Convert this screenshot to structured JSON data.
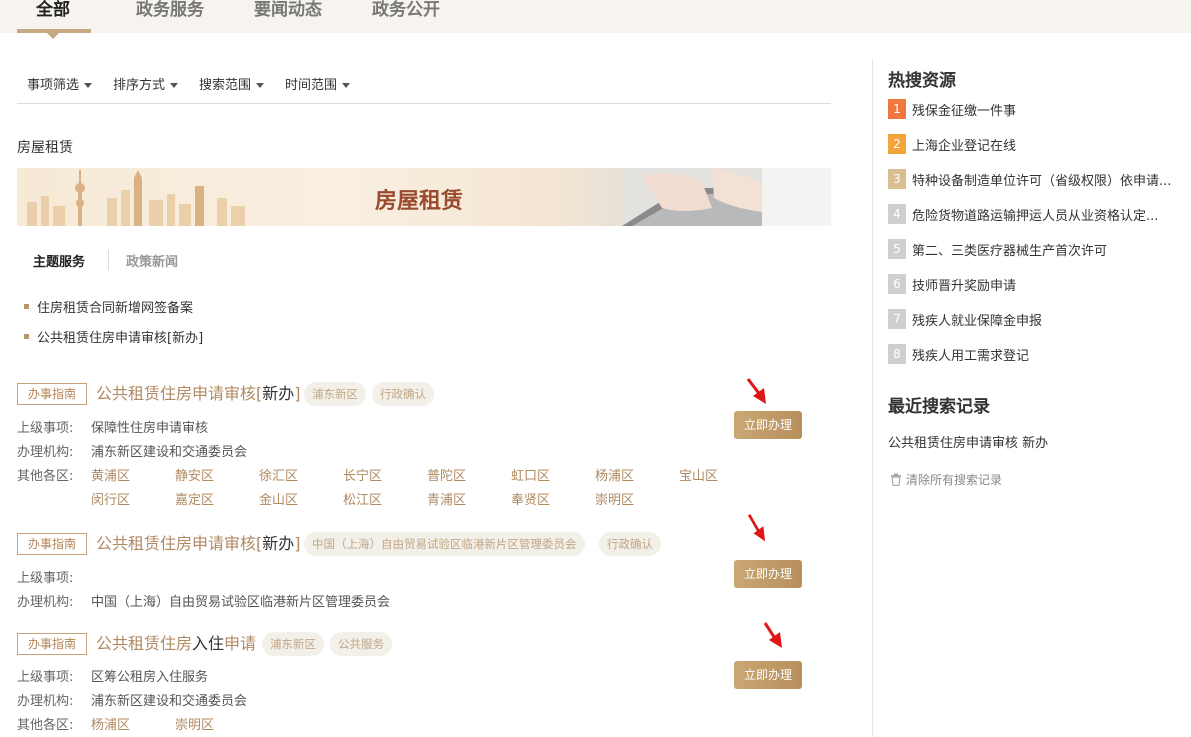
{
  "tabs": [
    "全部",
    "政务服务",
    "要闻动态",
    "政务公开"
  ],
  "filters": [
    "事项筛选",
    "排序方式",
    "搜索范围",
    "时间范围"
  ],
  "section_title": "房屋租赁",
  "banner_title": "房屋租赁",
  "subtabs": {
    "theme": "主题服务",
    "news": "政策新闻"
  },
  "bullets": [
    "住房租赁合同新增网签备案",
    "公共租赁住房申请审核[新办]"
  ],
  "labels": {
    "parent": "上级事项:",
    "org": "办理机构:",
    "other_districts": "其他各区:",
    "guide": "办事指南",
    "handle": "立即办理"
  },
  "results": [
    {
      "title_a": "公共租赁住房申请审核[",
      "title_b": "新办",
      "title_c": "]",
      "tags": [
        "浦东新区",
        "行政确认"
      ],
      "parent": "保障性住房申请审核",
      "org": "浦东新区建设和交通委员会",
      "districts": [
        "黄浦区",
        "静安区",
        "徐汇区",
        "长宁区",
        "普陀区",
        "虹口区",
        "杨浦区",
        "宝山区",
        "闵行区",
        "嘉定区",
        "金山区",
        "松江区",
        "青浦区",
        "奉贤区",
        "崇明区"
      ]
    },
    {
      "title_a": "公共租赁住房申请审核[",
      "title_b": "新办",
      "title_c": "]",
      "tags": [
        "中国（上海）自由贸易试验区临港新片区管理委员会",
        "行政确认"
      ],
      "parent": "",
      "org": "中国（上海）自由贸易试验区临港新片区管理委员会"
    },
    {
      "title_a": "公共租赁住房",
      "title_b": "入住",
      "title_c": "申请",
      "tags": [
        "浦东新区",
        "公共服务"
      ],
      "parent": "区筹公租房入住服务",
      "org": "浦东新区建设和交通委员会",
      "districts": [
        "杨浦区",
        "崇明区"
      ]
    }
  ],
  "hot": {
    "title": "热搜资源",
    "items": [
      {
        "num": "1",
        "text": "残保金征缴一件事",
        "color": "#f2773f"
      },
      {
        "num": "2",
        "text": "上海企业登记在线",
        "color": "#f5a43a"
      },
      {
        "num": "3",
        "text": "特种设备制造单位许可（省级权限）依申请...",
        "color": "#d9be8f"
      },
      {
        "num": "4",
        "text": "危险货物道路运输押运人员从业资格认定...",
        "color": "#cfcfcf"
      },
      {
        "num": "5",
        "text": "第二、三类医疗器械生产首次许可",
        "color": "#cfcfcf"
      },
      {
        "num": "6",
        "text": "技师晋升奖励申请",
        "color": "#cfcfcf"
      },
      {
        "num": "7",
        "text": "残疾人就业保障金申报",
        "color": "#cfcfcf"
      },
      {
        "num": "8",
        "text": "残疾人用工需求登记",
        "color": "#cfcfcf"
      }
    ]
  },
  "recent": {
    "title": "最近搜索记录",
    "item": "公共租赁住房申请审核 新办",
    "clear": "清除所有搜索记录"
  }
}
